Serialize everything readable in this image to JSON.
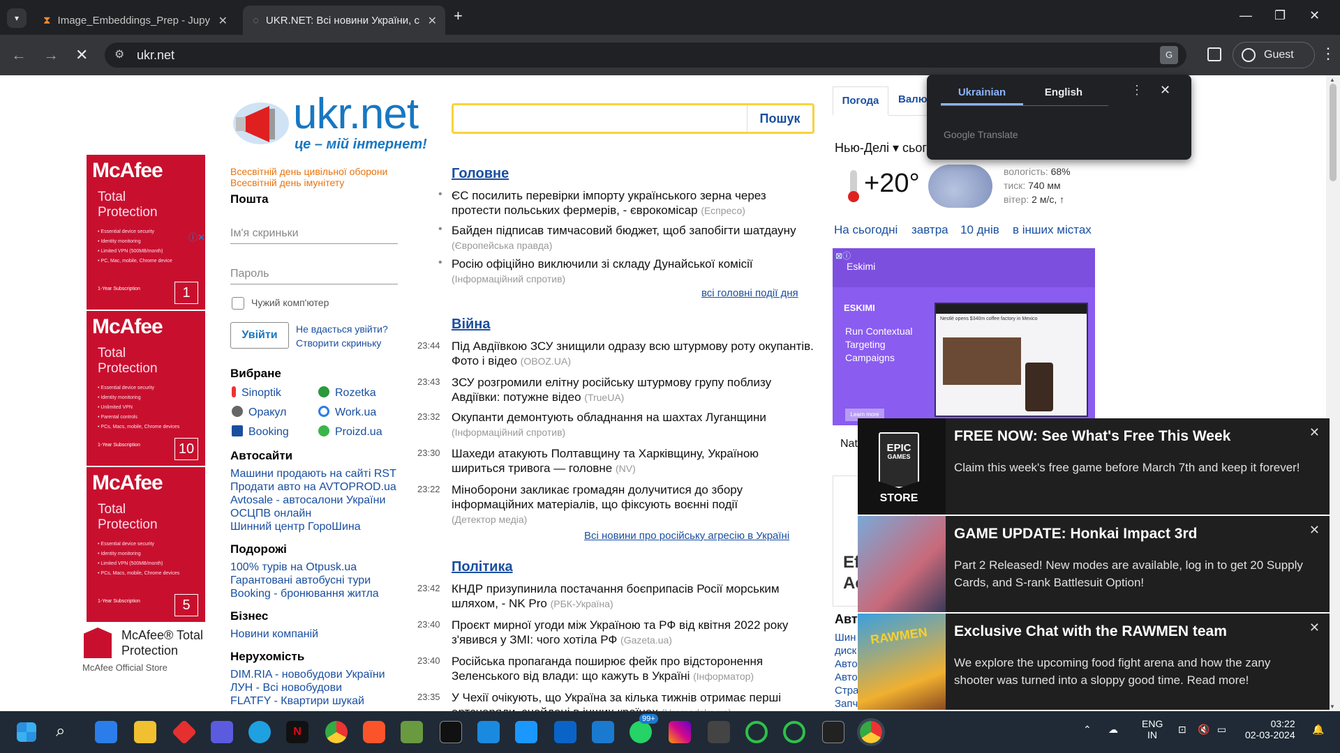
{
  "browser": {
    "tabs": [
      {
        "title": "Image_Embeddings_Prep - Jupy"
      },
      {
        "title": "UKR.NET: Всі новини України, с"
      }
    ],
    "url": "ukr.net",
    "profile": "Guest"
  },
  "translate_popup": {
    "source_lang": "Ukrainian",
    "target_lang": "English",
    "brand": "Google Translate"
  },
  "ads": {
    "mcafee": [
      {
        "brand": "McAfee",
        "product_line1": "Total",
        "product_line2": "Protection",
        "features": [
          "• Essential device security",
          "• Identity monitoring",
          "• Limited VPN (500MB/month)",
          "• PC, Mac, mobile, Chrome device"
        ],
        "sub": "1-Year Subscription",
        "devices": "1"
      },
      {
        "brand": "McAfee",
        "product_line1": "Total",
        "product_line2": "Protection",
        "features": [
          "• Essential device security",
          "• Identity monitoring",
          "• Unlimited VPN",
          "• Parental controls",
          "• PCs, Macs, mobile, Chrome devices"
        ],
        "sub": "1-Year Subscription",
        "devices": "10"
      },
      {
        "brand": "McAfee",
        "product_line1": "Total",
        "product_line2": "Protection",
        "features": [
          "• Essential device security",
          "• Identity monitoring",
          "• Limited VPN (500MB/month)",
          "• PCs, Macs, mobile, Chrome devices"
        ],
        "sub": "1-Year Subscription",
        "devices": "5"
      }
    ],
    "mcafee_footer_line1": "McAfee® Total",
    "mcafee_footer_line2": "Protection",
    "mcafee_store": "McAfee Official Store",
    "eskimi_tab": "Eskimi",
    "eskimi_logo": "ESKIMI",
    "eskimi_text": "Run Contextual Targeting Campaigns",
    "eskimi_btn": "Learn more",
    "eskimi_headline": "Nestlé opens $340m coffee factory in Mexico"
  },
  "site": {
    "logo": "ukr.net",
    "slogan": "це – мій інтернет!",
    "days": [
      "Всесвітній день цивільної оборони",
      "Всесвітній день імунітету"
    ],
    "search_btn": "Пошук",
    "mail": {
      "heading": "Пошта",
      "box_placeholder": "Ім'я скриньки",
      "pass_placeholder": "Пароль",
      "foreign": "Чужий комп'ютер",
      "login": "Увійти",
      "cant_login": "Не вдається увійти?",
      "create": "Створити скриньку"
    },
    "fav_heading": "Вибране",
    "favorites": [
      "Sinoptik",
      "Rozetka",
      "Оракул",
      "Work.ua",
      "Booking",
      "Proizd.ua"
    ],
    "auto_heading": "Автосайти",
    "auto_links": [
      "Машини продають на сайті RST",
      "Продати авто на AVTOPROD.ua",
      "Avtosale - автосалони України",
      "ОСЦПВ онлайн",
      "Шинний центр ГороШина"
    ],
    "travel_heading": "Подорожі",
    "travel_links": [
      "100% турів на Otpusk.ua",
      "Гарантовані автобусні тури",
      "Booking - бронювання житла"
    ],
    "biz_heading": "Бізнес",
    "biz_links": [
      "Новини компаній"
    ],
    "realty_heading": "Нерухомість",
    "realty_links": [
      "DIM.RIA - новобудови України",
      "ЛУН - Всі новобудови",
      "FLATFY - Квартири шукай"
    ]
  },
  "news": {
    "main": {
      "heading": "Головне",
      "items": [
        {
          "text": "ЄС посилить перевірки імпорту українського зерна через протести польських фермерів, - єврокомісар",
          "src": "(Еспресо)"
        },
        {
          "text": "Байден підписав тимчасовий бюджет, щоб запобігти шатдауну",
          "src": "(Європейська правда)"
        },
        {
          "text": "Росію офіційно виключили зі складу Дунайської комісії",
          "src": "(Інформаційний спротив)"
        }
      ],
      "more": "всі головні події дня"
    },
    "war": {
      "heading": "Війна",
      "items": [
        {
          "time": "23:44",
          "text": "Під Авдіївкою ЗСУ знищили одразу всю штурмову роту окупантів. Фото і відео",
          "src": "(OBOZ.UA)"
        },
        {
          "time": "23:43",
          "text": "ЗСУ розгромили елітну російську штурмову групу поблизу Авдіївки: потужне відео",
          "src": "(TrueUA)"
        },
        {
          "time": "23:32",
          "text": "Окупанти демонтують обладнання на шахтах Луганщини",
          "src": "(Інформаційний спротив)"
        },
        {
          "time": "23:30",
          "text": "Шахеди атакують Полтавщину та Харківщину, Україною шириться тривога — головне",
          "src": "(NV)"
        },
        {
          "time": "23:22",
          "text": "Міноборони закликає громадян долучитися до збору інформаційних матеріалів, що фіксують воєнні події",
          "src": "(Детектор медіа)"
        }
      ],
      "more": "Всі новини про російську агресію в Україні"
    },
    "politics": {
      "heading": "Політика",
      "items": [
        {
          "time": "23:42",
          "text": "КНДР призупинила постачання боєприпасів Росії морським шляхом, - NK Pro",
          "src": "(РБК-Україна)"
        },
        {
          "time": "23:40",
          "text": "Проєкт мирної угоди між Україною та РФ від квітня 2022 року з'явився у ЗМІ: чого хотіла РФ",
          "src": "(Gazeta.ua)"
        },
        {
          "time": "23:40",
          "text": "Російська пропаганда поширює фейк про відсторонення Зеленського від влади: що кажуть в Україні",
          "src": "(Інформатор)"
        },
        {
          "time": "23:35",
          "text": "У Чехії очікують, що Україна за кілька тижнів отримає перші артснаряди, знайдені в інших країнах",
          "src": "(Hromadske.ua)"
        }
      ]
    }
  },
  "weather": {
    "tab_weather": "Погода",
    "tab_currency": "Валю",
    "city": "Нью-Делі ▾",
    "city_suffix": "сьогод",
    "temp": "+20°",
    "humidity_label": "вологість:",
    "humidity": "68%",
    "pressure_label": "тиск:",
    "pressure": "740 мм",
    "wind_label": "вітер:",
    "wind": "2 м/с, ↑",
    "links": [
      "На сьогодні",
      "завтра",
      "10 днів",
      "в інших містах"
    ]
  },
  "right_col": {
    "nat": "Nat",
    "ef": "Ef",
    "ac": "Ac",
    "auto_heading": "Авто",
    "links": [
      "Шин",
      "диск",
      "Авто",
      "Авто",
      "Стра",
      "Запчаст. Kia, Hyundai"
    ]
  },
  "notifications": [
    {
      "title": "FREE NOW: See What's Free This Week",
      "body": "Claim this week's free game before March 7th and keep it forever!",
      "thumb_text": [
        "EPIC",
        "GAMES",
        "STORE"
      ]
    },
    {
      "title": "GAME UPDATE: Honkai Impact 3rd",
      "body": "Part 2 Released! New modes are available, log in to get 20 Supply Cards, and S-rank Battlesuit Option!"
    },
    {
      "title": "Exclusive Chat with the RAWMEN team",
      "body": "We explore the upcoming food fight arena and how the zany shooter was turned into a sloppy good time. Read more!",
      "thumb_text": [
        "RAWMEN"
      ]
    }
  ],
  "taskbar": {
    "lang": "ENG",
    "lang2": "IN",
    "time": "03:22",
    "date": "02-03-2024",
    "whatsapp_badge": "99+"
  }
}
